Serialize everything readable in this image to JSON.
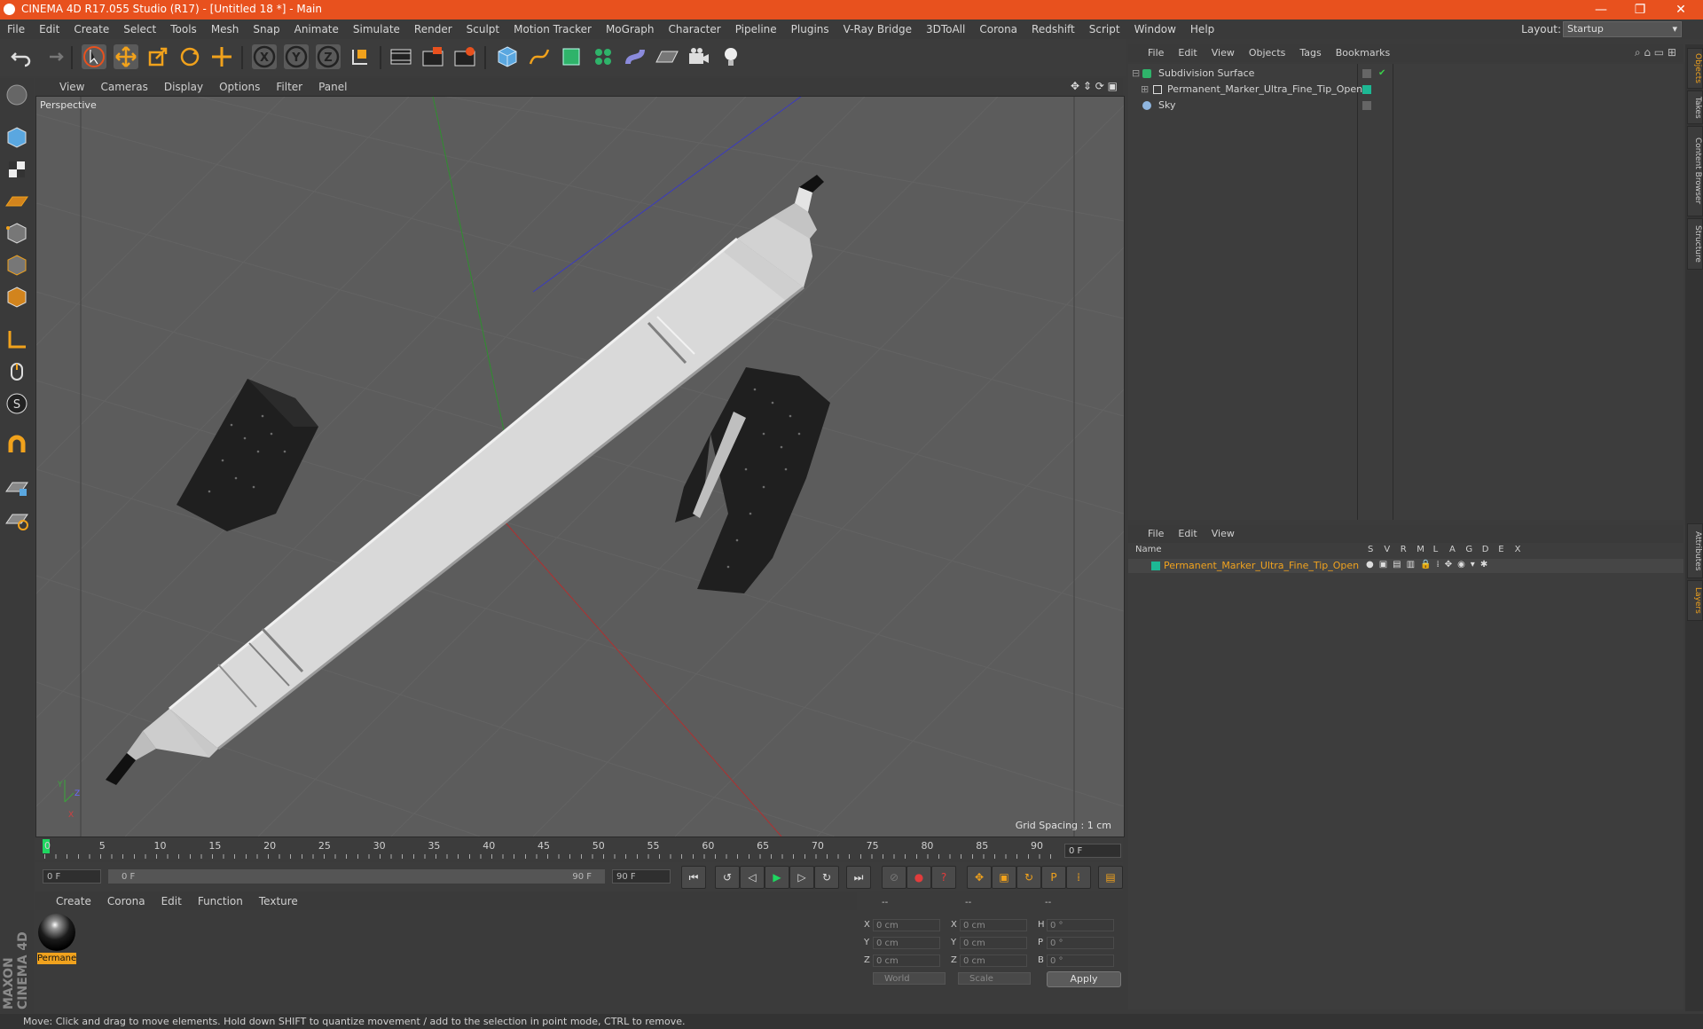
{
  "window": {
    "title": "CINEMA 4D R17.055 Studio (R17) - [Untitled 18 *] - Main",
    "minimize": "—",
    "maximize": "❐",
    "close": "✕"
  },
  "menubar": {
    "items": [
      "File",
      "Edit",
      "Create",
      "Select",
      "Tools",
      "Mesh",
      "Snap",
      "Animate",
      "Simulate",
      "Render",
      "Sculpt",
      "Motion Tracker",
      "MoGraph",
      "Character",
      "Pipeline",
      "Plugins",
      "V-Ray Bridge",
      "3DToAll",
      "Corona",
      "Redshift",
      "Script",
      "Window",
      "Help"
    ],
    "layout_label": "Layout:",
    "layout_value": "Startup"
  },
  "toolbar": {
    "icons": [
      "undo-icon",
      "redo-icon",
      "select-arrow-icon",
      "move-icon",
      "scale-icon",
      "rotate-icon",
      "live-move-icon",
      "x-axis-icon",
      "y-axis-icon",
      "z-axis-icon",
      "coordinate-system-icon",
      "render-view-icon",
      "render-picture-viewer-icon",
      "edit-render-settings-icon",
      "cube-primitive-icon",
      "pen-spline-icon",
      "subdivision-generator-icon",
      "cloner-icon",
      "deformer-icon",
      "floor-icon",
      "camera-icon",
      "light-icon"
    ]
  },
  "viewport": {
    "menu": [
      "View",
      "Cameras",
      "Display",
      "Options",
      "Filter",
      "Panel"
    ],
    "label": "Perspective",
    "grid_spacing": "Grid Spacing : 1 cm",
    "axis_y": "Y",
    "axis_z": "Z",
    "axis_x": "X"
  },
  "timeline": {
    "ticks": [
      "0",
      "5",
      "10",
      "15",
      "20",
      "25",
      "30",
      "35",
      "40",
      "45",
      "50",
      "55",
      "60",
      "65",
      "70",
      "75",
      "80",
      "85",
      "90"
    ],
    "current_frame": "0 F",
    "start_field": "0 F",
    "range_start": "0 F",
    "range_end": "90 F",
    "end_field": "90 F"
  },
  "material_manager": {
    "menu": [
      "Create",
      "Corona",
      "Edit",
      "Function",
      "Texture"
    ],
    "material_name": "Permanent"
  },
  "coordinates": {
    "header": [
      "--",
      "--",
      "--"
    ],
    "rows": [
      {
        "axis": "X",
        "pos": "0 cm",
        "axis2": "X",
        "size": "0 cm",
        "rot_label": "H",
        "rot": "0 °"
      },
      {
        "axis": "Y",
        "pos": "0 cm",
        "axis2": "Y",
        "size": "0 cm",
        "rot_label": "P",
        "rot": "0 °"
      },
      {
        "axis": "Z",
        "pos": "0 cm",
        "axis2": "Z",
        "size": "0 cm",
        "rot_label": "B",
        "rot": "0 °"
      }
    ],
    "mode1": "World",
    "mode2": "Scale",
    "apply": "Apply"
  },
  "object_manager": {
    "menu": [
      "File",
      "Edit",
      "View",
      "Objects",
      "Tags",
      "Bookmarks"
    ],
    "objects": [
      {
        "name": "Subdivision Surface"
      },
      {
        "name": "Permanent_Marker_Ultra_Fine_Tip_Open"
      },
      {
        "name": "Sky"
      }
    ]
  },
  "layer_manager": {
    "menu": [
      "File",
      "Edit",
      "View"
    ],
    "columns": [
      "Name",
      "S",
      "V",
      "R",
      "M",
      "L",
      "A",
      "G",
      "D",
      "E",
      "X"
    ],
    "layer_name": "Permanent_Marker_Ultra_Fine_Tip_Open"
  },
  "right_tabs": [
    "Objects",
    "Takes",
    "Content Browser",
    "Structure",
    "Attributes",
    "Layers"
  ],
  "status": "Move: Click and drag to move elements. Hold down SHIFT to quantize movement / add to the selection in point mode, CTRL to remove.",
  "branding": "MAXON CINEMA 4D",
  "colors": {
    "accent": "#e8511e",
    "selected": "#f0a21e",
    "layer_green": "#1db894"
  }
}
